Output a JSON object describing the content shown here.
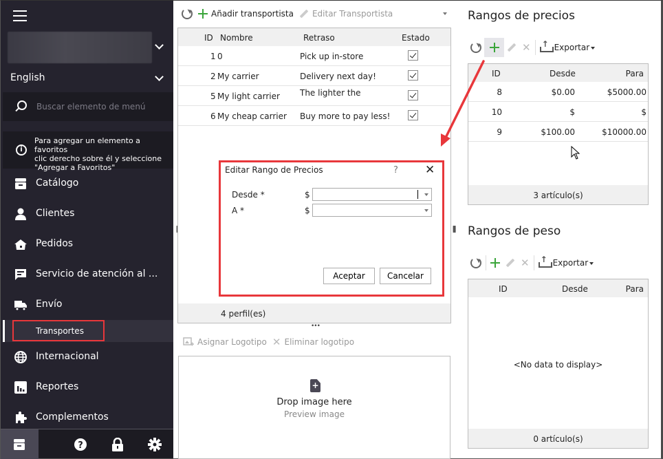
{
  "sidebar": {
    "language": "English",
    "search_placeholder": "Buscar elemento de menú",
    "favorites_hint": [
      "Para agregar un elemento a favoritos",
      "clic derecho sobre él y seleccione",
      "\"Agregar a Favoritos\""
    ],
    "items": [
      {
        "label": "Catálogo",
        "icon": "archive-icon"
      },
      {
        "label": "Clientes",
        "icon": "person-icon"
      },
      {
        "label": "Pedidos",
        "icon": "basket-icon"
      },
      {
        "label": "Servicio de atención al ...",
        "icon": "chat-icon"
      },
      {
        "label": "Envío",
        "icon": "truck-icon"
      },
      {
        "label": "Internacional",
        "icon": "globe-icon"
      },
      {
        "label": "Reportes",
        "icon": "chart-icon"
      },
      {
        "label": "Complementos",
        "icon": "puzzle-icon"
      }
    ],
    "active_subitem": "Transportes",
    "footer_icons": [
      "archive-icon",
      "help-icon",
      "lock-icon",
      "gear-icon"
    ]
  },
  "carriers": {
    "toolbar": {
      "add_label": "Añadir transportista",
      "edit_label": "Editar Transportista"
    },
    "columns": [
      "ID",
      "Nombre",
      "Retraso",
      "Estado"
    ],
    "rows": [
      {
        "id": "1",
        "name": "0",
        "delay": "Pick up in-store",
        "active": true
      },
      {
        "id": "2",
        "name": "My carrier",
        "delay": "Delivery next day!",
        "active": true
      },
      {
        "id": "5",
        "name": "My light carrier",
        "delay": "The lighter the",
        "active": true
      },
      {
        "id": "6",
        "name": "My cheap carrier",
        "delay": "Buy more to pay less!",
        "active": true
      }
    ],
    "footer": "4 perfil(es)"
  },
  "logo": {
    "assign_label": "Asignar Logotipo",
    "remove_label": "Eliminar logotipo",
    "drop_text": "Drop image here",
    "preview_text": "Preview image"
  },
  "dialog": {
    "title": "Editar Rango de Precios",
    "help": "?",
    "close": "✕",
    "fields": [
      {
        "label": "Desde *",
        "currency": "$",
        "value": ""
      },
      {
        "label": "A *",
        "currency": "$",
        "value": ""
      }
    ],
    "ok_label": "Aceptar",
    "cancel_label": "Cancelar"
  },
  "price_ranges": {
    "title": "Rangos de precios",
    "export_label": "Exportar",
    "columns": [
      "ID",
      "Desde",
      "Para"
    ],
    "rows": [
      {
        "id": "8",
        "from": "$0.00",
        "to": "$5000.00"
      },
      {
        "id": "10",
        "from": "$",
        "to": "$"
      },
      {
        "id": "9",
        "from": "$100.00",
        "to": "$10000.00"
      }
    ],
    "footer": "3 artículo(s)"
  },
  "weight_ranges": {
    "title": "Rangos de peso",
    "export_label": "Exportar",
    "columns": [
      "ID",
      "Desde",
      "Para"
    ],
    "empty_text": "<No data to display>",
    "footer": "0 artículo(s)"
  },
  "colors": {
    "sidebar_bg": "#25232e",
    "highlight_red": "#e8373b",
    "add_green": "#3aa53a"
  }
}
